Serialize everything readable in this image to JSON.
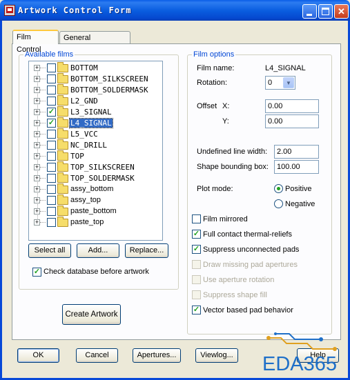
{
  "window": {
    "title": "Artwork Control Form",
    "close_glyph": "✕"
  },
  "tabs": [
    {
      "label": "Film Control",
      "active": true
    },
    {
      "label": "General Parameters",
      "active": false
    }
  ],
  "available_films": {
    "title": "Available films",
    "films": [
      {
        "name": "BOTTOM",
        "checked": false,
        "selected": false
      },
      {
        "name": "BOTTOM_SILKSCREEN",
        "checked": false,
        "selected": false
      },
      {
        "name": "BOTTOM_SOLDERMASK",
        "checked": false,
        "selected": false
      },
      {
        "name": "L2_GND",
        "checked": false,
        "selected": false
      },
      {
        "name": "L3_SIGNAL",
        "checked": true,
        "selected": false
      },
      {
        "name": "L4_SIGNAL",
        "checked": true,
        "selected": true
      },
      {
        "name": "L5_VCC",
        "checked": false,
        "selected": false
      },
      {
        "name": "NC_DRILL",
        "checked": false,
        "selected": false
      },
      {
        "name": "TOP",
        "checked": false,
        "selected": false
      },
      {
        "name": "TOP_SILKSCREEN",
        "checked": false,
        "selected": false
      },
      {
        "name": "TOP_SOLDERMASK",
        "checked": false,
        "selected": false
      },
      {
        "name": "assy_bottom",
        "checked": false,
        "selected": false
      },
      {
        "name": "assy_top",
        "checked": false,
        "selected": false
      },
      {
        "name": "paste_bottom",
        "checked": false,
        "selected": false
      },
      {
        "name": "paste_top",
        "checked": false,
        "selected": false
      }
    ],
    "expander_glyph": "+",
    "check_glyph": "✓",
    "select_all_label": "Select all",
    "add_label": "Add...",
    "replace_label": "Replace...",
    "check_db_label": "Check database before artwork",
    "check_db_checked": true,
    "create_artwork_label": "Create Artwork"
  },
  "film_options": {
    "title": "Film options",
    "film_name_label": "Film name:",
    "film_name_value": "L4_SIGNAL",
    "rotation_label": "Rotation:",
    "rotation_value": "0",
    "combo_arrow": "▼",
    "offset_label": "Offset",
    "x_label": "X:",
    "x_value": "0.00",
    "y_label": "Y:",
    "y_value": "0.00",
    "undefined_line_width_label": "Undefined line width:",
    "undefined_line_width_value": "2.00",
    "shape_bounding_box_label": "Shape bounding box:",
    "shape_bounding_box_value": "100.00",
    "plot_mode_label": "Plot mode:",
    "plot_mode_options": [
      "Positive",
      "Negative"
    ],
    "plot_mode_selected": "Positive",
    "options": [
      {
        "label": "Film mirrored",
        "checked": false,
        "enabled": true
      },
      {
        "label": "Full contact thermal-reliefs",
        "checked": true,
        "enabled": true
      },
      {
        "label": "Suppress unconnected pads",
        "checked": true,
        "enabled": true
      },
      {
        "label": "Draw missing pad apertures",
        "checked": false,
        "enabled": false
      },
      {
        "label": "Use aperture rotation",
        "checked": false,
        "enabled": false
      },
      {
        "label": "Suppress shape fill",
        "checked": false,
        "enabled": false
      },
      {
        "label": "Vector based pad behavior",
        "checked": true,
        "enabled": true
      }
    ]
  },
  "footer": {
    "ok_label": "OK",
    "cancel_label": "Cancel",
    "apertures_label": "Apertures...",
    "viewlog_label": "Viewlog...",
    "help_label": "Help"
  },
  "watermark": {
    "text": "EDA365"
  },
  "colors": {
    "titlebar": "#0a5ee8",
    "group_title": "#0046d5",
    "selection": "#316ac5",
    "check": "#21a121",
    "watermark": "#1e6fc8"
  }
}
